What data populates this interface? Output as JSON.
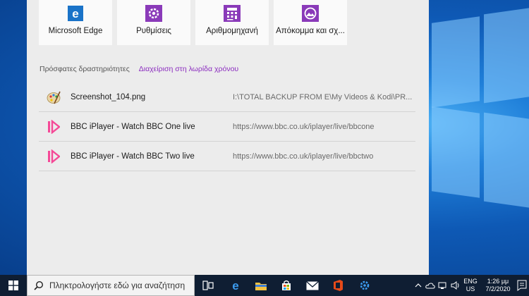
{
  "pinned_tiles": [
    {
      "label": "Microsoft Edge",
      "icon": "edge-icon",
      "color": "#1a73c8"
    },
    {
      "label": "Ρυθμίσεις",
      "icon": "settings-gear-icon",
      "color": "#8a3ab9"
    },
    {
      "label": "Αριθμομηχανή",
      "icon": "calculator-icon",
      "color": "#8a3ab9"
    },
    {
      "label": "Απόκομμα και σχ...",
      "icon": "snip-sketch-icon",
      "color": "#8a3ab9"
    }
  ],
  "recent": {
    "title": "Πρόσφατες δραστηριότητες",
    "manage_link": "Διαχείριση στη λωρίδα χρόνου",
    "items": [
      {
        "name": "Screenshot_104.png",
        "path": "I:\\TOTAL BACKUP FROM E\\My Videos & Kodi\\PR...",
        "icon": "paint-palette-icon"
      },
      {
        "name": "BBC iPlayer - Watch BBC One live",
        "path": "https://www.bbc.co.uk/iplayer/live/bbcone",
        "icon": "iplayer-icon"
      },
      {
        "name": "BBC iPlayer - Watch BBC Two live",
        "path": "https://www.bbc.co.uk/iplayer/live/bbctwo",
        "icon": "iplayer-icon"
      }
    ]
  },
  "taskbar": {
    "search_placeholder": "Πληκτρολογήστε εδώ για αναζήτηση",
    "language_line1": "ENG",
    "language_line2": "US",
    "time": "1:26 μμ",
    "date": "7/2/2020"
  },
  "colors": {
    "accent_purple": "#8b2cbf",
    "taskbar_bg": "#0f1e33",
    "panel_bg": "#ececec"
  }
}
